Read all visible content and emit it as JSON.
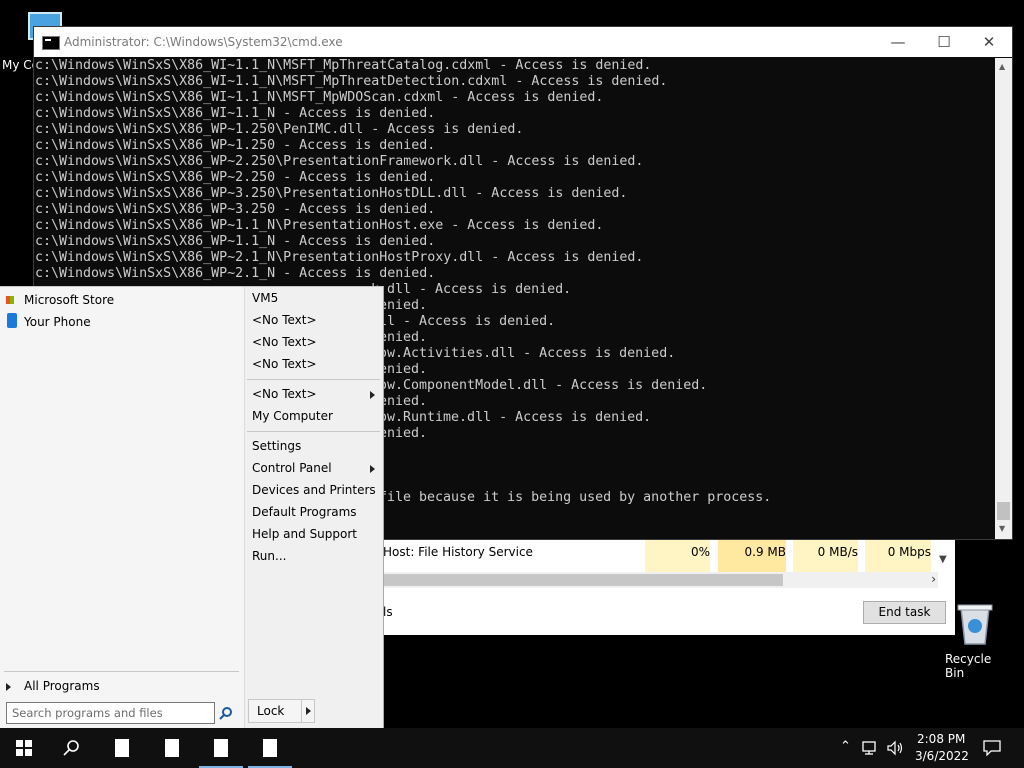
{
  "desktop": {
    "my_computer_label": "My Co",
    "recycle_bin_label": "Recycle Bin"
  },
  "cmd": {
    "title": "Administrator: C:\\Windows\\System32\\cmd.exe",
    "lines": [
      "c:\\Windows\\WinSxS\\X86_WI~1.1_N\\MSFT_MpThreatCatalog.cdxml - Access is denied.",
      "c:\\Windows\\WinSxS\\X86_WI~1.1_N\\MSFT_MpThreatDetection.cdxml - Access is denied.",
      "c:\\Windows\\WinSxS\\X86_WI~1.1_N\\MSFT_MpWDOScan.cdxml - Access is denied.",
      "c:\\Windows\\WinSxS\\X86_WI~1.1_N - Access is denied.",
      "c:\\Windows\\WinSxS\\X86_WP~1.250\\PenIMC.dll - Access is denied.",
      "c:\\Windows\\WinSxS\\X86_WP~1.250 - Access is denied.",
      "c:\\Windows\\WinSxS\\X86_WP~2.250\\PresentationFramework.dll - Access is denied.",
      "c:\\Windows\\WinSxS\\X86_WP~2.250 - Access is denied.",
      "c:\\Windows\\WinSxS\\X86_WP~3.250\\PresentationHostDLL.dll - Access is denied.",
      "c:\\Windows\\WinSxS\\X86_WP~3.250 - Access is denied.",
      "c:\\Windows\\WinSxS\\X86_WP~1.1_N\\PresentationHost.exe - Access is denied.",
      "c:\\Windows\\WinSxS\\X86_WP~1.1_N - Access is denied.",
      "c:\\Windows\\WinSxS\\X86_WP~2.1_N\\PresentationHostProxy.dll - Access is denied.",
      "c:\\Windows\\WinSxS\\X86_WP~2.1_N - Access is denied."
    ],
    "partial_lines": [
      "k.dll - Access is denied.",
      "enied.",
      "ll - Access is denied.",
      "enied.",
      "ow.Activities.dll - Access is denied.",
      "enied.",
      "ow.ComponentModel.dll - Access is denied.",
      "enied.",
      "ow.Runtime.dll - Access is denied.",
      "enied."
    ],
    "last_partial": "file because it is being used by another process."
  },
  "task_manager": {
    "service_name": "Host: File History Service",
    "cpu": "0%",
    "memory": "0.9 MB",
    "disk": "0 MB/s",
    "network": "0 Mbps",
    "fewer_details_fragment": "ls",
    "end_task_label": "End task"
  },
  "start_menu": {
    "pinned": [
      {
        "label": "Microsoft Store",
        "icon": "store-icon"
      },
      {
        "label": "Your Phone",
        "icon": "phone-icon"
      }
    ],
    "all_programs_label": "All Programs",
    "search_placeholder": "Search programs and files",
    "right_items_top": [
      "VM5",
      "<No Text>",
      "<No Text>",
      "<No Text>"
    ],
    "right_items_mid": [
      "<No Text>",
      "My Computer"
    ],
    "right_items_bottom": [
      "Settings",
      "Control Panel",
      "Devices and Printers",
      "Default Programs",
      "Help and Support",
      "Run..."
    ],
    "lock_label": "Lock"
  },
  "taskbar": {
    "time": "2:08 PM",
    "date": "3/6/2022"
  },
  "colors": {
    "console_bg": "#0c0c0c",
    "console_text": "#cccccc",
    "heat_cell": "#fff4c4",
    "active_underline": "#7fb2e5"
  }
}
